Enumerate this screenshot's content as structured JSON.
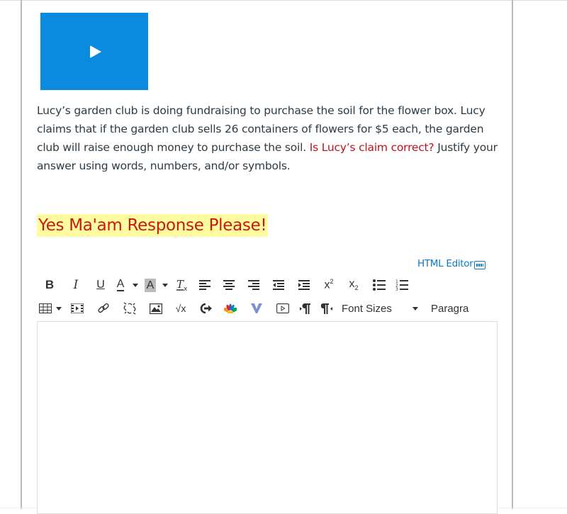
{
  "video": {
    "play_icon": "play-icon"
  },
  "question": {
    "text_part1": "Lucy’s garden club is doing fundraising to purchase the soil for the flower box.  Lucy claims that if the garden club sells 26 containers of flowers for $5 each, the garden club will raise enough money to purchase the soil.  ",
    "text_highlight": "Is Lucy’s claim correct?",
    "text_part2": "  Justify your answer using words, numbers, and/or symbols.",
    "highlight_color": "#c1121c"
  },
  "response_heading": "Yes Ma'am Response Please!",
  "editor": {
    "html_editor_link": "HTML Editor",
    "toolbar_row1": [
      "bold",
      "italic",
      "underline",
      "text-color",
      "background-color",
      "clear-formatting",
      "align-left",
      "align-center",
      "align-right",
      "outdent",
      "indent",
      "superscript",
      "subscript",
      "bullet-list",
      "numbered-list"
    ],
    "toolbar_row2": [
      "table",
      "media",
      "link",
      "unlink",
      "image",
      "equation",
      "lti-tool",
      "nbc-learn",
      "vimeo",
      "embed-video",
      "ltr",
      "rtl"
    ],
    "labels": {
      "bold": "B",
      "italic": "I",
      "underline": "U",
      "text_color": "A",
      "background_color": "A",
      "superscript": "x",
      "subscript": "x",
      "sup_num": "2",
      "sub_num": "2"
    },
    "font_sizes_label": "Font Sizes",
    "paragraph_label": "Paragra",
    "content": ""
  }
}
